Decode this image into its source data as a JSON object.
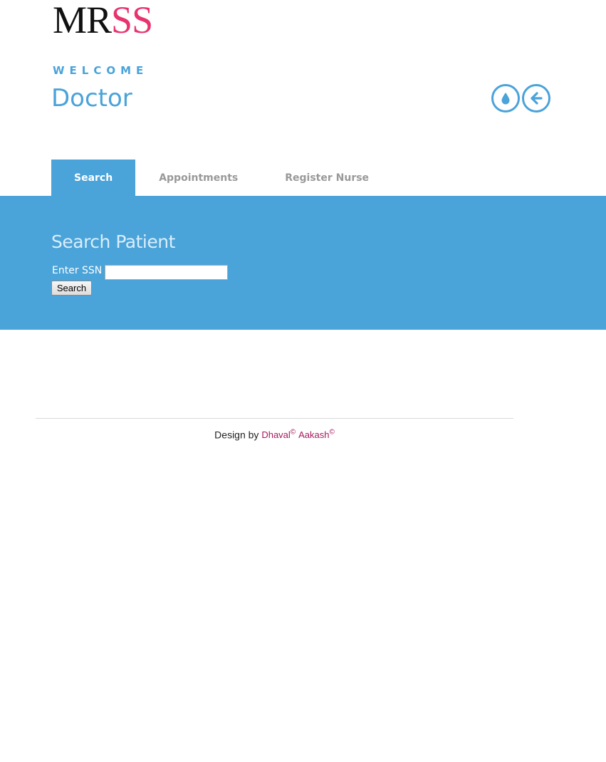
{
  "logo": {
    "part1": "MR",
    "part2": "SS"
  },
  "header": {
    "welcome": "WELCOME",
    "role": "Doctor"
  },
  "icons": {
    "drop": "drop-icon",
    "back": "arrow-left-icon"
  },
  "tabs": [
    {
      "label": "Search",
      "active": true
    },
    {
      "label": "Appointments",
      "active": false
    },
    {
      "label": "Register Nurse",
      "active": false
    }
  ],
  "search": {
    "title": "Search Patient",
    "label": "Enter SSN",
    "value": "",
    "button": "Search"
  },
  "footer": {
    "prefix": "Design by",
    "author1": "Dhaval",
    "author2": "Aakash",
    "mark": "©"
  },
  "colors": {
    "accent": "#4aa3d9",
    "brand_pink": "#e8336e",
    "link": "#a8165e"
  }
}
